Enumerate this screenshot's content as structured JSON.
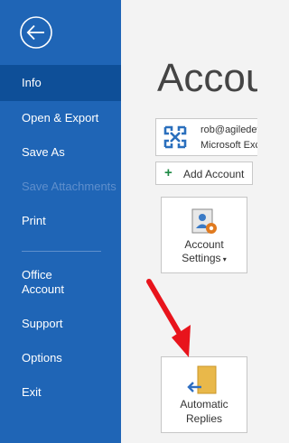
{
  "nav": {
    "items": [
      {
        "label": "Info"
      },
      {
        "label": "Open & Export"
      },
      {
        "label": "Save As"
      },
      {
        "label": "Save Attachments"
      },
      {
        "label": "Print"
      },
      {
        "label": "Office Account"
      },
      {
        "label": "Support"
      },
      {
        "label": "Options"
      },
      {
        "label": "Exit"
      }
    ]
  },
  "main": {
    "title": "Account Information",
    "account": {
      "email": "rob@agiledev.com",
      "type": "Microsoft Exchange"
    },
    "add_account_label": "Add Account",
    "tiles": {
      "account_settings": {
        "line1": "Account",
        "line2": "Settings"
      },
      "automatic_replies": {
        "line1": "Automatic",
        "line2": "Replies"
      }
    }
  },
  "colors": {
    "sidebar": "#1f65b6",
    "sidebar_selected": "#0e4f98",
    "annotation_arrow": "#e8141c"
  }
}
